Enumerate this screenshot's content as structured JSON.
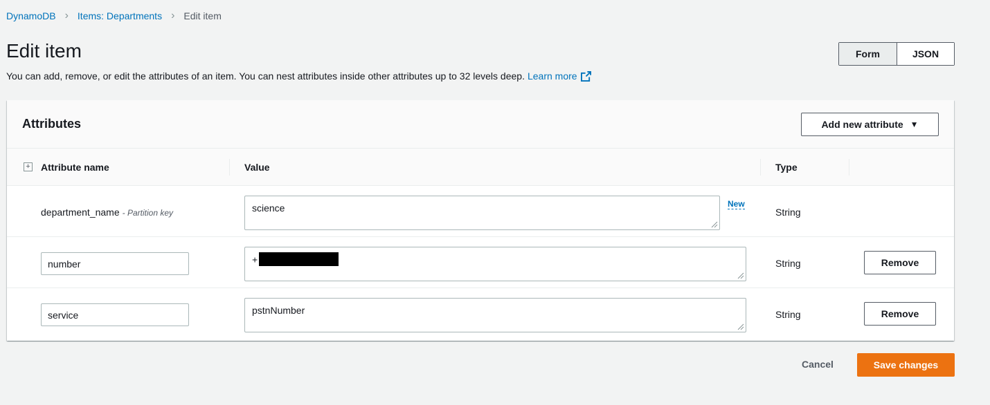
{
  "breadcrumb": {
    "items": [
      "DynamoDB",
      "Items: Departments"
    ],
    "current": "Edit item"
  },
  "page": {
    "title": "Edit item",
    "description": "You can add, remove, or edit the attributes of an item. You can nest attributes inside other attributes up to 32 levels deep.",
    "learn_more": "Learn more"
  },
  "view_toggle": {
    "options": [
      "Form",
      "JSON"
    ],
    "selected": "Form"
  },
  "attributes": {
    "title": "Attributes",
    "add_button": "Add new attribute",
    "columns": [
      "Attribute name",
      "Value",
      "Type"
    ],
    "rows": [
      {
        "name": "department_name",
        "key_note": "- Partition key",
        "value": "science",
        "tag": "New",
        "type": "String"
      },
      {
        "name": "number",
        "value": "+",
        "type": "String",
        "remove": "Remove"
      },
      {
        "name": "service",
        "value": "pstnNumber",
        "type": "String",
        "remove": "Remove"
      }
    ]
  },
  "actions": {
    "cancel": "Cancel",
    "save": "Save changes"
  },
  "colors": {
    "link": "#0073bb",
    "primary": "#ec7211",
    "background": "#f2f3f3"
  }
}
